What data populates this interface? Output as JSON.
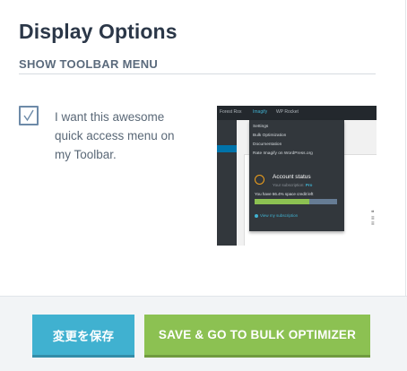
{
  "dialog": {
    "title": "Display Options",
    "section_heading": "SHOW TOOLBAR MENU",
    "option": {
      "checked": true,
      "label": "I want this awesome quick access menu on my Toolbar."
    }
  },
  "preview": {
    "adminbar": [
      "Forest Rox",
      "Imagify",
      "WP Rocket"
    ],
    "menu_items": [
      "Settings",
      "Bulk Optimization",
      "Documentation",
      "Rate Imagify on WordPress.org"
    ],
    "account_status": "Account status",
    "subscription_prefix": "Your subscription:",
    "subscription_plan": "Pro",
    "space_credit": "You have 66.4% space credit left",
    "space_credit_fraction": 0.664,
    "view_subscription": "View my subscription",
    "colors": {
      "adminbar": "#23282d",
      "dropdown": "#32373c",
      "bar_fill": "#8cc152",
      "bar_track": "#667c94",
      "ring": "#f0a01c",
      "accent": "#40b1d0"
    }
  },
  "footer": {
    "save_label": "変更を保存",
    "save_go_label": "SAVE & GO TO BULK OPTIMIZER"
  },
  "colors": {
    "title": "#2b3748",
    "save_button": "#40b1d0",
    "go_button": "#8cc152",
    "checkbox_border": "#6d8aa8"
  }
}
